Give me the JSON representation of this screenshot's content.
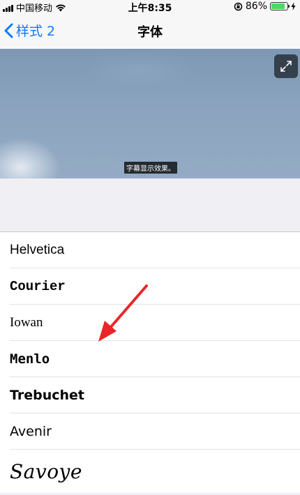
{
  "status": {
    "carrier": "中国移动",
    "time": "上午8:35",
    "battery_percent": "86%",
    "battery_level": 0.86
  },
  "nav": {
    "back_label": "样式 2",
    "title": "字体"
  },
  "preview": {
    "caption": "字幕显示效果。"
  },
  "fonts": [
    {
      "label": "Helvetica"
    },
    {
      "label": "Courier"
    },
    {
      "label": "Iowan"
    },
    {
      "label": "Menlo"
    },
    {
      "label": "Trebuchet"
    },
    {
      "label": "Avenir"
    },
    {
      "label": "Savoye"
    }
  ],
  "colors": {
    "accent": "#0a7aff",
    "arrow": "#e8262a",
    "battery": "#4cd964"
  }
}
